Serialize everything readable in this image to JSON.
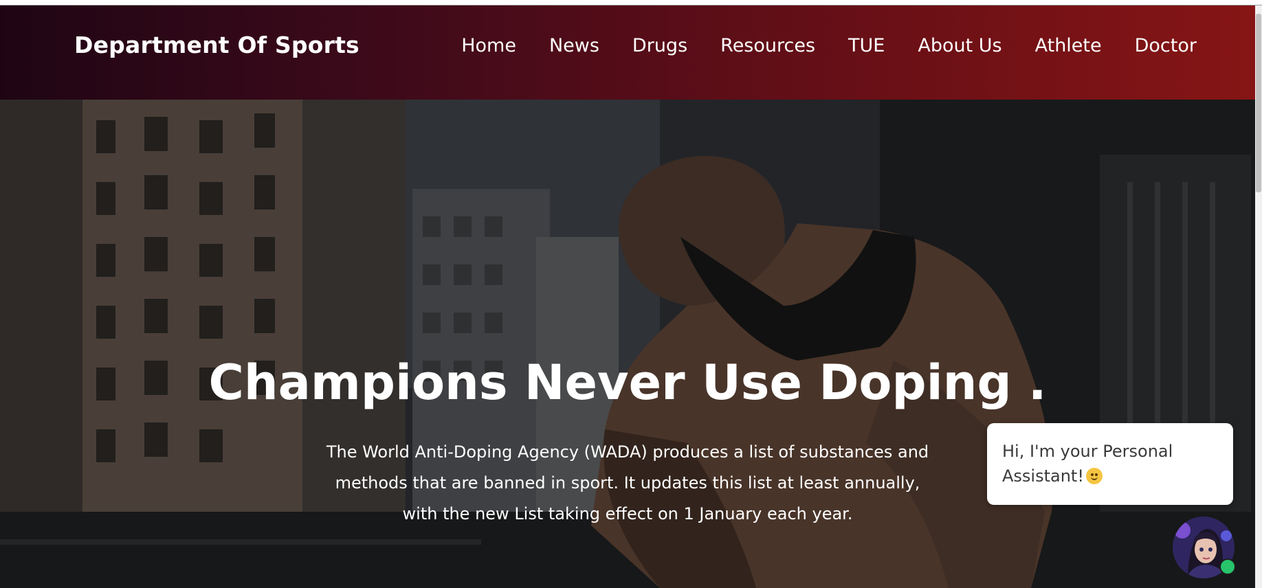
{
  "navbar": {
    "brand": "Department Of Sports",
    "links": [
      {
        "label": "Home"
      },
      {
        "label": "News"
      },
      {
        "label": "Drugs"
      },
      {
        "label": "Resources"
      },
      {
        "label": "TUE"
      },
      {
        "label": "About Us"
      },
      {
        "label": "Athlete"
      },
      {
        "label": "Doctor"
      }
    ]
  },
  "hero": {
    "title": "Champions Never Use Doping .",
    "description": "The World Anti-Doping Agency (WADA) produces a list of substances and methods that are banned in sport. It updates this list at least annually, with the new List taking effect on 1 January each year.",
    "background_image": "athlete-tying-shoe-city-street"
  },
  "chat": {
    "greeting": "Hi, I'm your Personal Assistant!",
    "emoji_icon": "smiling-face-icon",
    "avatar_icon": "assistant-avatar-icon",
    "status": "online",
    "status_color": "#27c46b"
  },
  "colors": {
    "navbar_start": "#1f0514",
    "navbar_end": "#861515",
    "text": "#ffffff"
  }
}
